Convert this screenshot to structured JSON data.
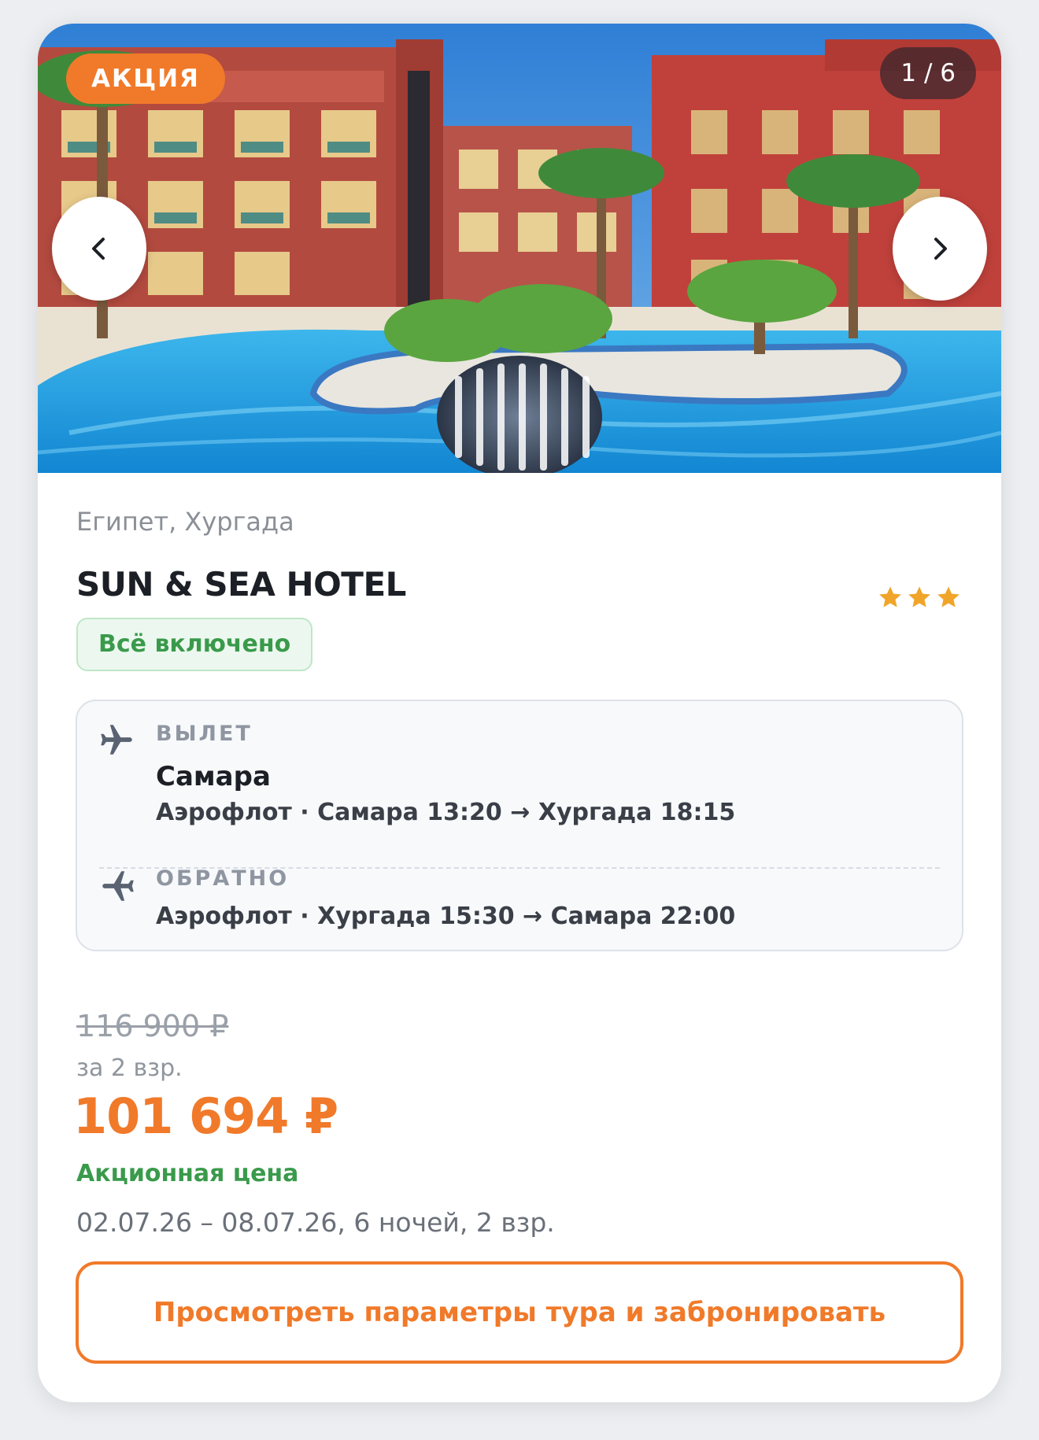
{
  "gallery": {
    "promo_badge": "АКЦИЯ",
    "counter": "1 / 6",
    "prev_icon": "chevron-left-icon",
    "next_icon": "chevron-right-icon",
    "current_slide": 1,
    "total_slides": 6
  },
  "hotel": {
    "location": "Египет, Хургада",
    "name": "SUN & SEA HOTEL",
    "stars": 3,
    "star_color": "#f0a52a",
    "meal_plan": "Всё включено"
  },
  "flights": {
    "departure": {
      "label": "ВЫЛЕТ",
      "city": "Самара",
      "route": "Аэрофлот · Самара 13:20 → Хургада 18:15",
      "icon": "plane-departure-icon"
    },
    "return": {
      "label": "ОБРАТНО",
      "route": "Аэрофлот · Хургада 15:30 → Самара 22:00",
      "icon": "plane-return-icon"
    }
  },
  "pricing": {
    "old_price": "116 900 ₽",
    "note": "за 2 взр.",
    "price": "101 694 ₽",
    "promo_label": "Акционная цена",
    "dates": "02.07.26 – 08.07.26, 6 ночей, 2 взр."
  },
  "actions": {
    "book_label": "Просмотреть параметры тура и забронировать"
  },
  "colors": {
    "accent": "#f07a2a",
    "success": "#3a9a4b"
  }
}
